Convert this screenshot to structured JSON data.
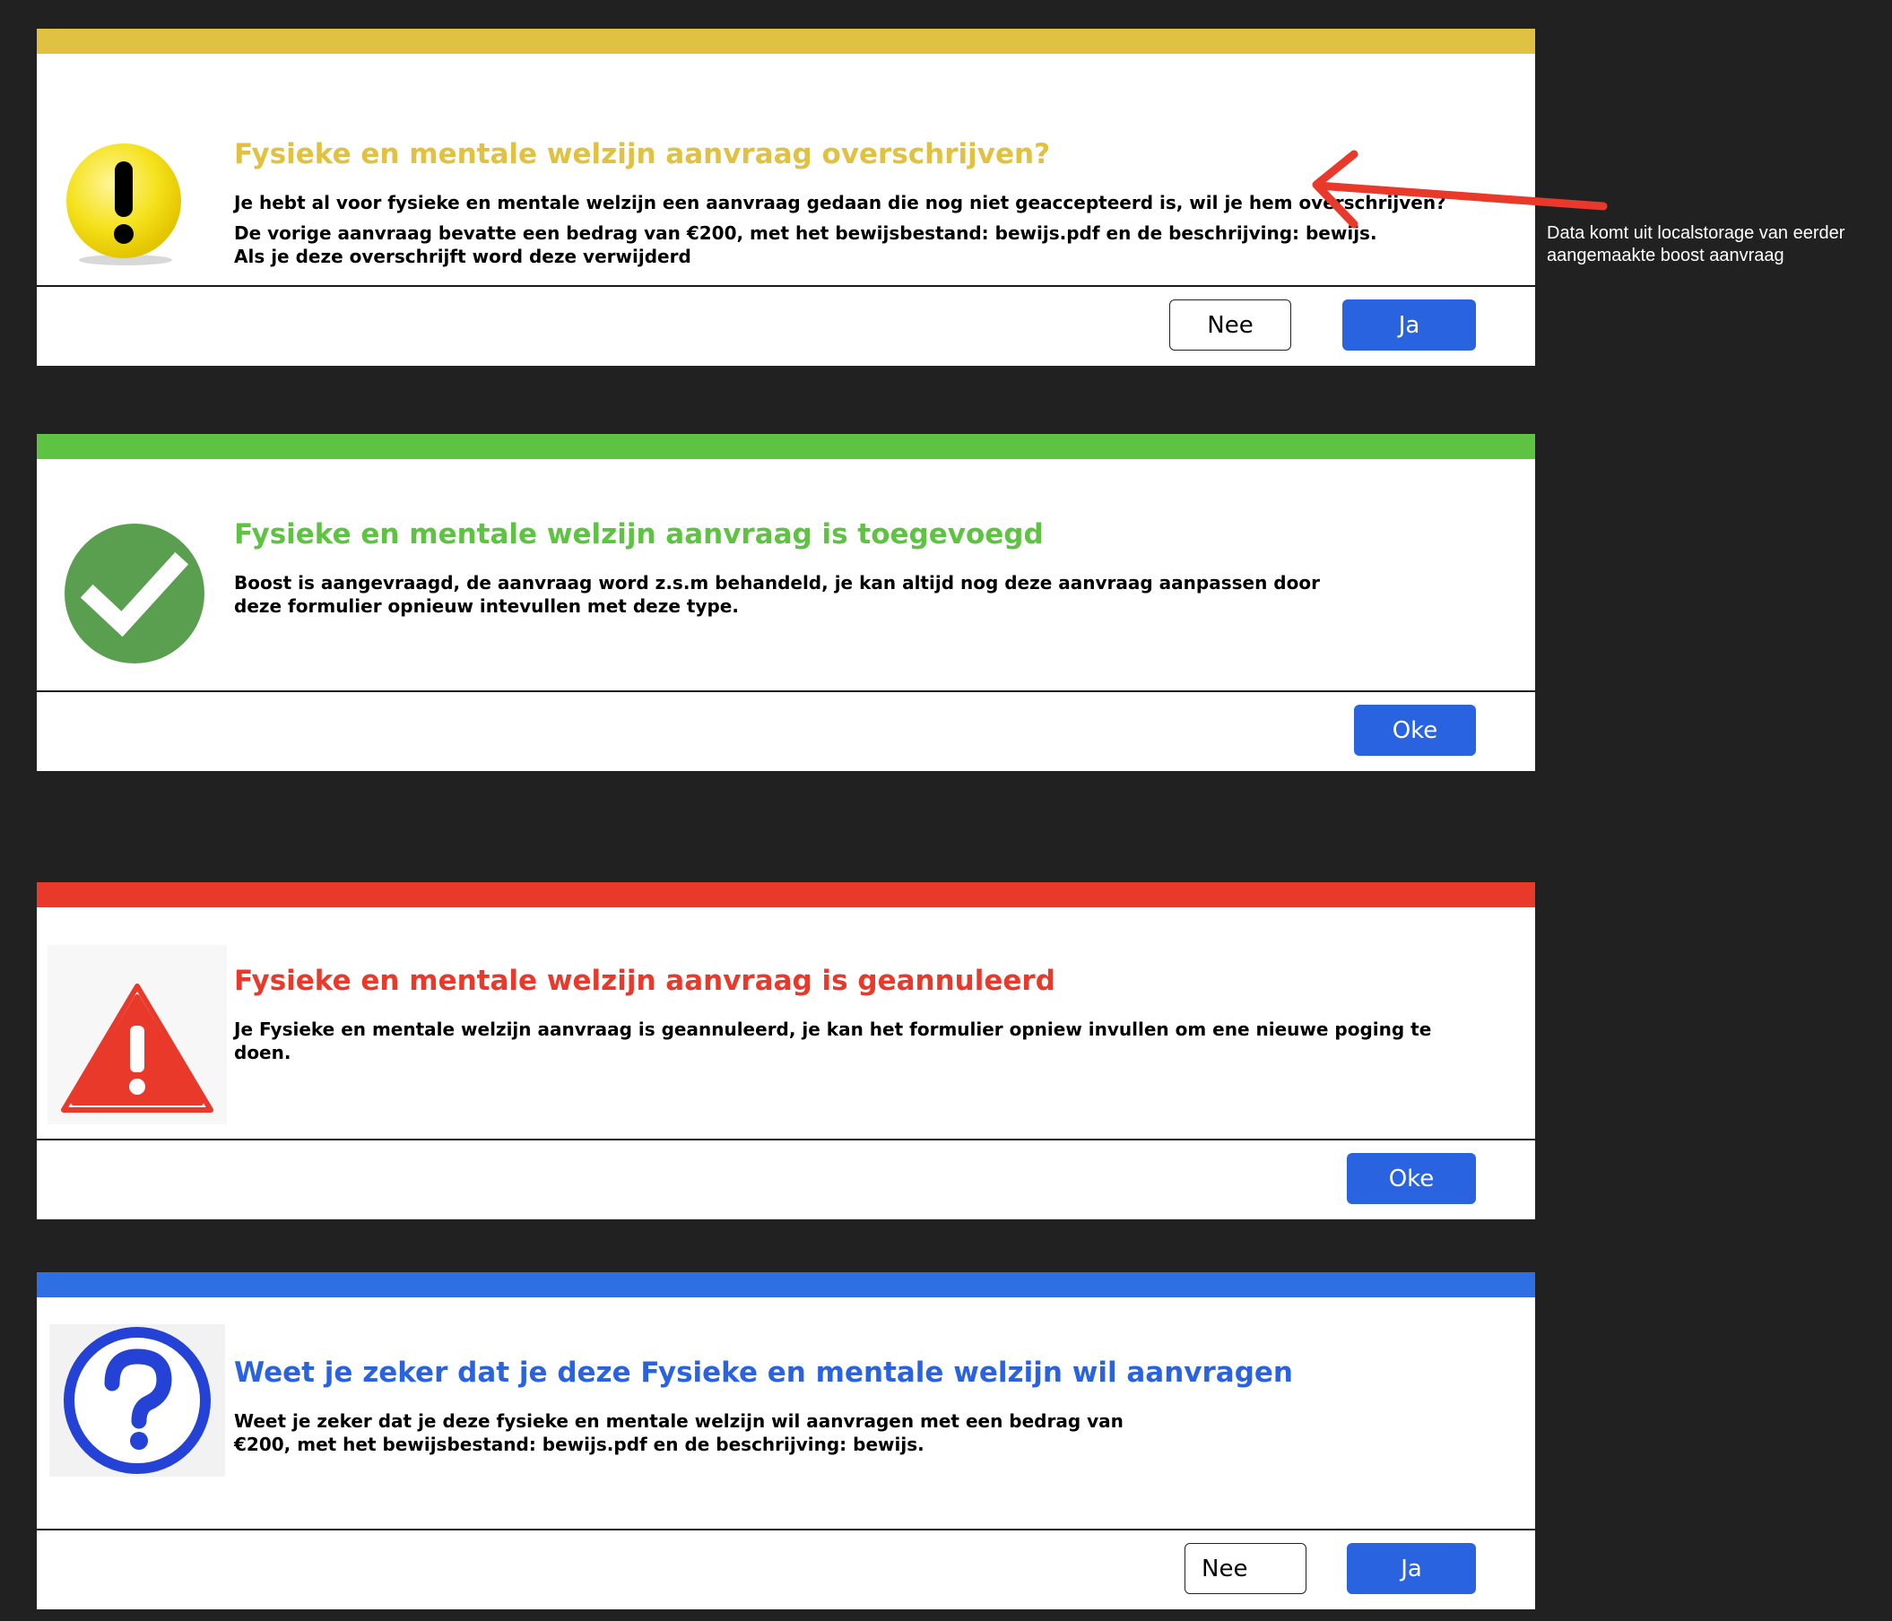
{
  "colors": {
    "yellow": "#e0c142",
    "green": "#5ec342",
    "red": "#e8392b",
    "blue": "#2a63e0",
    "background": "#212121"
  },
  "dialogs": [
    {
      "type": "warning",
      "icon": "exclamation-icon",
      "title": "Fysieke en mentale welzijn aanvraag overschrijven?",
      "lines": [
        "Je hebt al voor fysieke en mentale welzijn een aanvraag gedaan die nog niet geaccepteerd is, wil je hem overschrijven?",
        "De vorige aanvraag bevatte een bedrag van €200, met het bewijsbestand: bewijs.pdf en de beschrijving: bewijs.",
        "Als je deze overschrijft word deze verwijderd"
      ],
      "buttons": {
        "secondary": "Nee",
        "primary": "Ja"
      }
    },
    {
      "type": "success",
      "icon": "checkmark-icon",
      "title": "Fysieke en mentale welzijn aanvraag is toegevoegd",
      "lines": [
        "Boost is aangevraagd, de aanvraag word z.s.m behandeld, je kan altijd nog deze aanvraag aanpassen door deze formulier opnieuw intevullen met deze type."
      ],
      "buttons": {
        "primary": "Oke"
      }
    },
    {
      "type": "error",
      "icon": "warning-triangle-icon",
      "title": "Fysieke en mentale welzijn aanvraag is geannuleerd",
      "lines": [
        "Je Fysieke en mentale welzijn aanvraag is geannuleerd, je kan het formulier opniew invullen om ene nieuwe poging te doen."
      ],
      "buttons": {
        "primary": "Oke"
      }
    },
    {
      "type": "confirm",
      "icon": "question-mark-icon",
      "title": "Weet je zeker dat je deze Fysieke en mentale welzijn wil aanvragen",
      "lines": [
        "Weet je zeker dat je deze fysieke en mentale welzijn wil aanvragen met een bedrag van €200, met het bewijsbestand: bewijs.pdf en de beschrijving: bewijs."
      ],
      "buttons": {
        "secondary": "Nee",
        "primary": "Ja"
      }
    }
  ],
  "annotation": {
    "text": "Data komt uit localstorage van eerder aangemaakte boost aanvraag",
    "arrow_icon": "red-arrow-icon"
  }
}
